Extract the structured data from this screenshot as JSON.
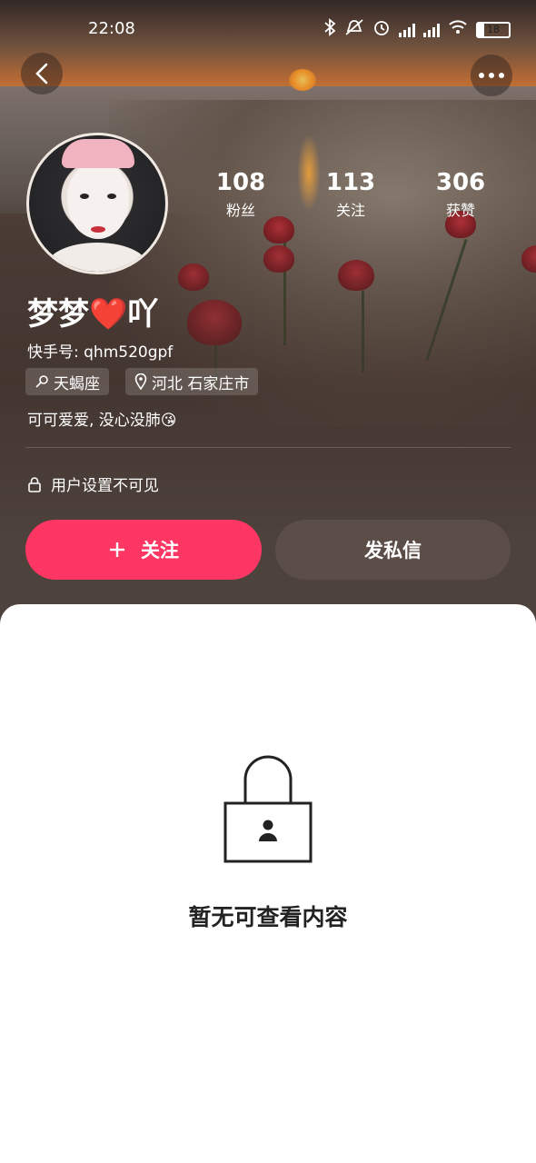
{
  "status_bar": {
    "time": "22:08",
    "battery": "18"
  },
  "profile": {
    "name": "梦梦",
    "name_heart": "❤️",
    "name_suffix": "吖",
    "kuaishou_id": "快手号: qhm520gpf",
    "tags": {
      "zodiac": "天蝎座",
      "location": "河北 石家庄市"
    },
    "bio": "可可爱爱, 没心没肺😘",
    "privacy_note": "用户设置不可见"
  },
  "stats": [
    {
      "value": "108",
      "label": "粉丝"
    },
    {
      "value": "113",
      "label": "关注"
    },
    {
      "value": "306",
      "label": "获赞"
    }
  ],
  "actions": {
    "follow": "关注",
    "message": "发私信"
  },
  "empty_state": {
    "text": "暂无可查看内容"
  },
  "icons": {
    "back": "chevron-left-icon",
    "more": "more-icon",
    "zodiac": "zodiac-icon",
    "location": "location-pin-icon",
    "privacy": "lock-icon",
    "follow": "plus-icon",
    "empty": "lock-user-icon"
  },
  "colors": {
    "accent": "#fe3663",
    "message_button": "#5b4d48"
  }
}
